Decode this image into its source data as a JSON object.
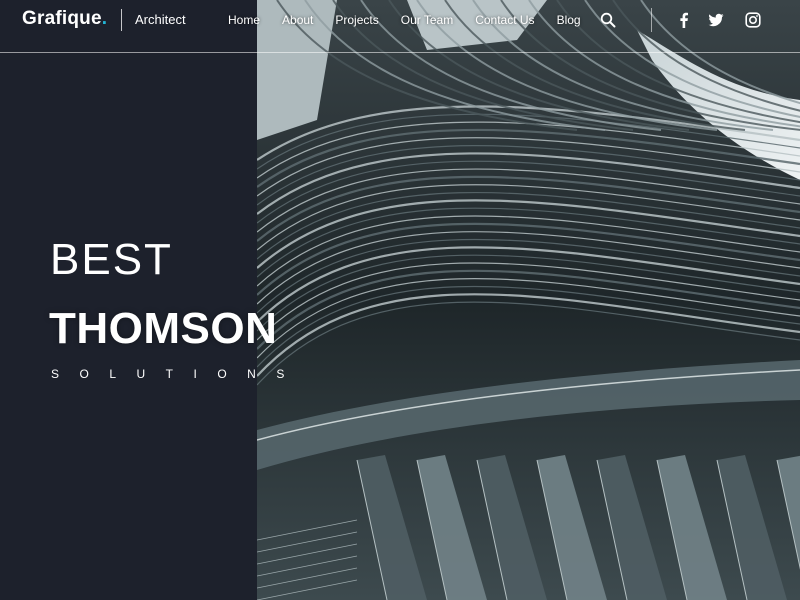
{
  "header": {
    "brand_name": "Grafique",
    "brand_dot": ".",
    "tagline": "Architect",
    "nav": [
      {
        "label": "Home"
      },
      {
        "label": "About"
      },
      {
        "label": "Projects"
      },
      {
        "label": "Our Team"
      },
      {
        "label": "Contact Us"
      },
      {
        "label": "Blog"
      }
    ],
    "icons": [
      "search-icon",
      "facebook-icon",
      "twitter-icon",
      "instagram-icon"
    ]
  },
  "hero": {
    "line1": "BEST",
    "line2": "THOMSON",
    "line3": "SOLUTIONS"
  },
  "colors": {
    "panel_bg": "#1d212c",
    "brand_accent": "#23b6d6",
    "text": "#ffffff"
  }
}
